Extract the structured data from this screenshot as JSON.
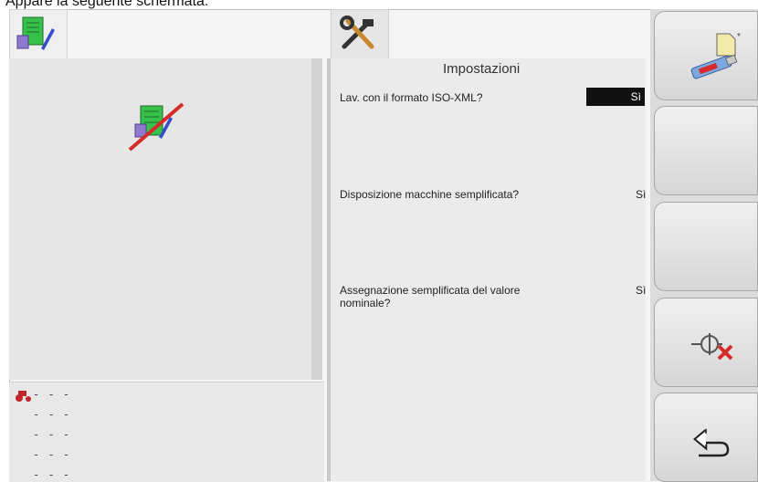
{
  "caption": "Appare la seguente schermata:",
  "left_tab": {
    "icon": "task-document-icon"
  },
  "left_panel": {
    "status_icon": "task-document-disabled-icon",
    "tractor_icon": "tractor-icon",
    "rows": [
      "- - -",
      "- - -",
      "- - -",
      "- - -",
      "- - -"
    ]
  },
  "mid_tab": {
    "icon": "tools-wrench-hammer-icon"
  },
  "settings": {
    "title": "Impostazioni",
    "items": [
      {
        "label": "Lav. con il formato ISO-XML?",
        "value": "Sì"
      },
      {
        "label": "Disposizione macchine semplificata?",
        "value": "Sì"
      },
      {
        "label": "Assegnazione semplificata del valore nominale?",
        "value": "Sì"
      }
    ]
  },
  "softkeys": {
    "usb_new_file": {
      "icon": "usb-new-file-icon"
    },
    "empty1": {},
    "empty2": {},
    "disconnect": {
      "icon": "disconnect-cancel-icon"
    },
    "back": {
      "icon": "back-return-icon"
    }
  },
  "colors": {
    "active_value_bg": "#111111",
    "cross_red": "#d52b2b"
  }
}
